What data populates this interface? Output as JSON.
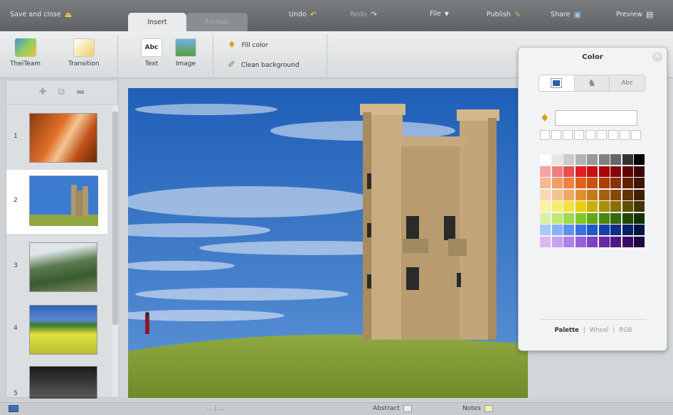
{
  "topbar": {
    "save_close": "Save and close",
    "undo": "Undo",
    "redo": "Redo",
    "file": "File",
    "publish": "Publish",
    "share": "Share",
    "preview": "Preview"
  },
  "tabs": [
    {
      "label": "Insert",
      "active": true
    },
    {
      "label": "Format",
      "active": false
    }
  ],
  "ribbon": {
    "theiteam": "TheiTeam",
    "transition": "Transition",
    "text": "Text",
    "image": "Image",
    "fill_color": "Fill color",
    "clean_background": "Clean background"
  },
  "thumbnails": [
    {
      "num": "1",
      "icon": "canyon-image"
    },
    {
      "num": "2",
      "icon": "castle-image",
      "selected": true
    },
    {
      "num": "3",
      "icon": "mountain-image"
    },
    {
      "num": "4",
      "icon": "field-image"
    },
    {
      "num": "5",
      "icon": "dark-image"
    }
  ],
  "statusbar": {
    "center": "... | ...",
    "abstract": "Abstract",
    "notes": "Notes"
  },
  "color_panel": {
    "title": "Color",
    "tabs": [
      "",
      "",
      "Abc"
    ],
    "hex_value": "",
    "footer": [
      "Palette",
      "|",
      "Wheel",
      "|",
      "RGB"
    ],
    "active_mode": "Palette"
  },
  "palette": [
    [
      "#ffffff",
      "#e6e6e6",
      "#cccccc",
      "#b3b3b3",
      "#999999",
      "#808080",
      "#666666",
      "#333333",
      "#000000"
    ],
    [
      "#f4a3a3",
      "#f08080",
      "#e85050",
      "#e02020",
      "#c81010",
      "#a80808",
      "#880606",
      "#600404",
      "#400202"
    ],
    [
      "#f6b890",
      "#f29c68",
      "#ee8040",
      "#e06020",
      "#c85010",
      "#a84008",
      "#883006",
      "#602004",
      "#401402"
    ],
    [
      "#f8d8b0",
      "#f4c490",
      "#eeaa60",
      "#e09030",
      "#c87820",
      "#a86010",
      "#884808",
      "#603404",
      "#402202"
    ],
    [
      "#fcf4a0",
      "#f8ec70",
      "#f4e040",
      "#e8d010",
      "#c8b008",
      "#a89006",
      "#887004",
      "#605002",
      "#403400"
    ],
    [
      "#d8f0a0",
      "#c0e878",
      "#a0d850",
      "#80c828",
      "#60a818",
      "#488810",
      "#346808",
      "#224804",
      "#143002"
    ],
    [
      "#a8c8f8",
      "#88b0f4",
      "#6090ee",
      "#3870e0",
      "#2058c8",
      "#1440a8",
      "#0c3088",
      "#082060",
      "#041440"
    ],
    [
      "#d8b8f0",
      "#c8a0ec",
      "#b080e4",
      "#9860d8",
      "#8040c0",
      "#6828a0",
      "#501880",
      "#380c60",
      "#200440"
    ]
  ],
  "colors": {
    "topbar": "#6a6d6f",
    "ribbon": "#e4e6e7",
    "panel": "#f2f3f4"
  }
}
